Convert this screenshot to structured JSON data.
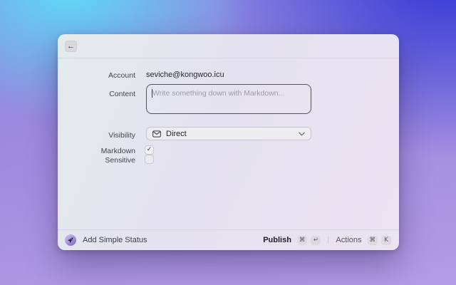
{
  "window": {
    "header": {
      "back_icon": "←"
    },
    "form": {
      "account_label": "Account",
      "account_value": "seviche@kongwoo.icu",
      "content_label": "Content",
      "content_placeholder": "Write something down with Markdown...",
      "visibility_label": "Visibility",
      "visibility_value": "Direct",
      "markdown_label": "Markdown",
      "markdown_checked": true,
      "sensitive_label": "Sensitive",
      "sensitive_checked": false
    },
    "footer": {
      "add_simple_status_label": "Add Simple Status",
      "publish_label": "Publish",
      "publish_keys": [
        "⌘",
        "↵"
      ],
      "actions_label": "Actions",
      "actions_keys": [
        "⌘",
        "K"
      ]
    }
  },
  "icons": {
    "back": "←",
    "checkmark": "✓",
    "envelope": "envelope-icon",
    "chevron": "chevron-down-icon",
    "app": "rocket-app-icon"
  },
  "colors": {
    "desktop_cyan": "#5edcf8",
    "desktop_indigo": "#3036d5",
    "desktop_purple": "#b49de4",
    "window_bg": "#e6e3f1",
    "textarea_border": "#55525c",
    "divider": "#d7d4dd",
    "keycap_bg": "#dcdae0"
  }
}
